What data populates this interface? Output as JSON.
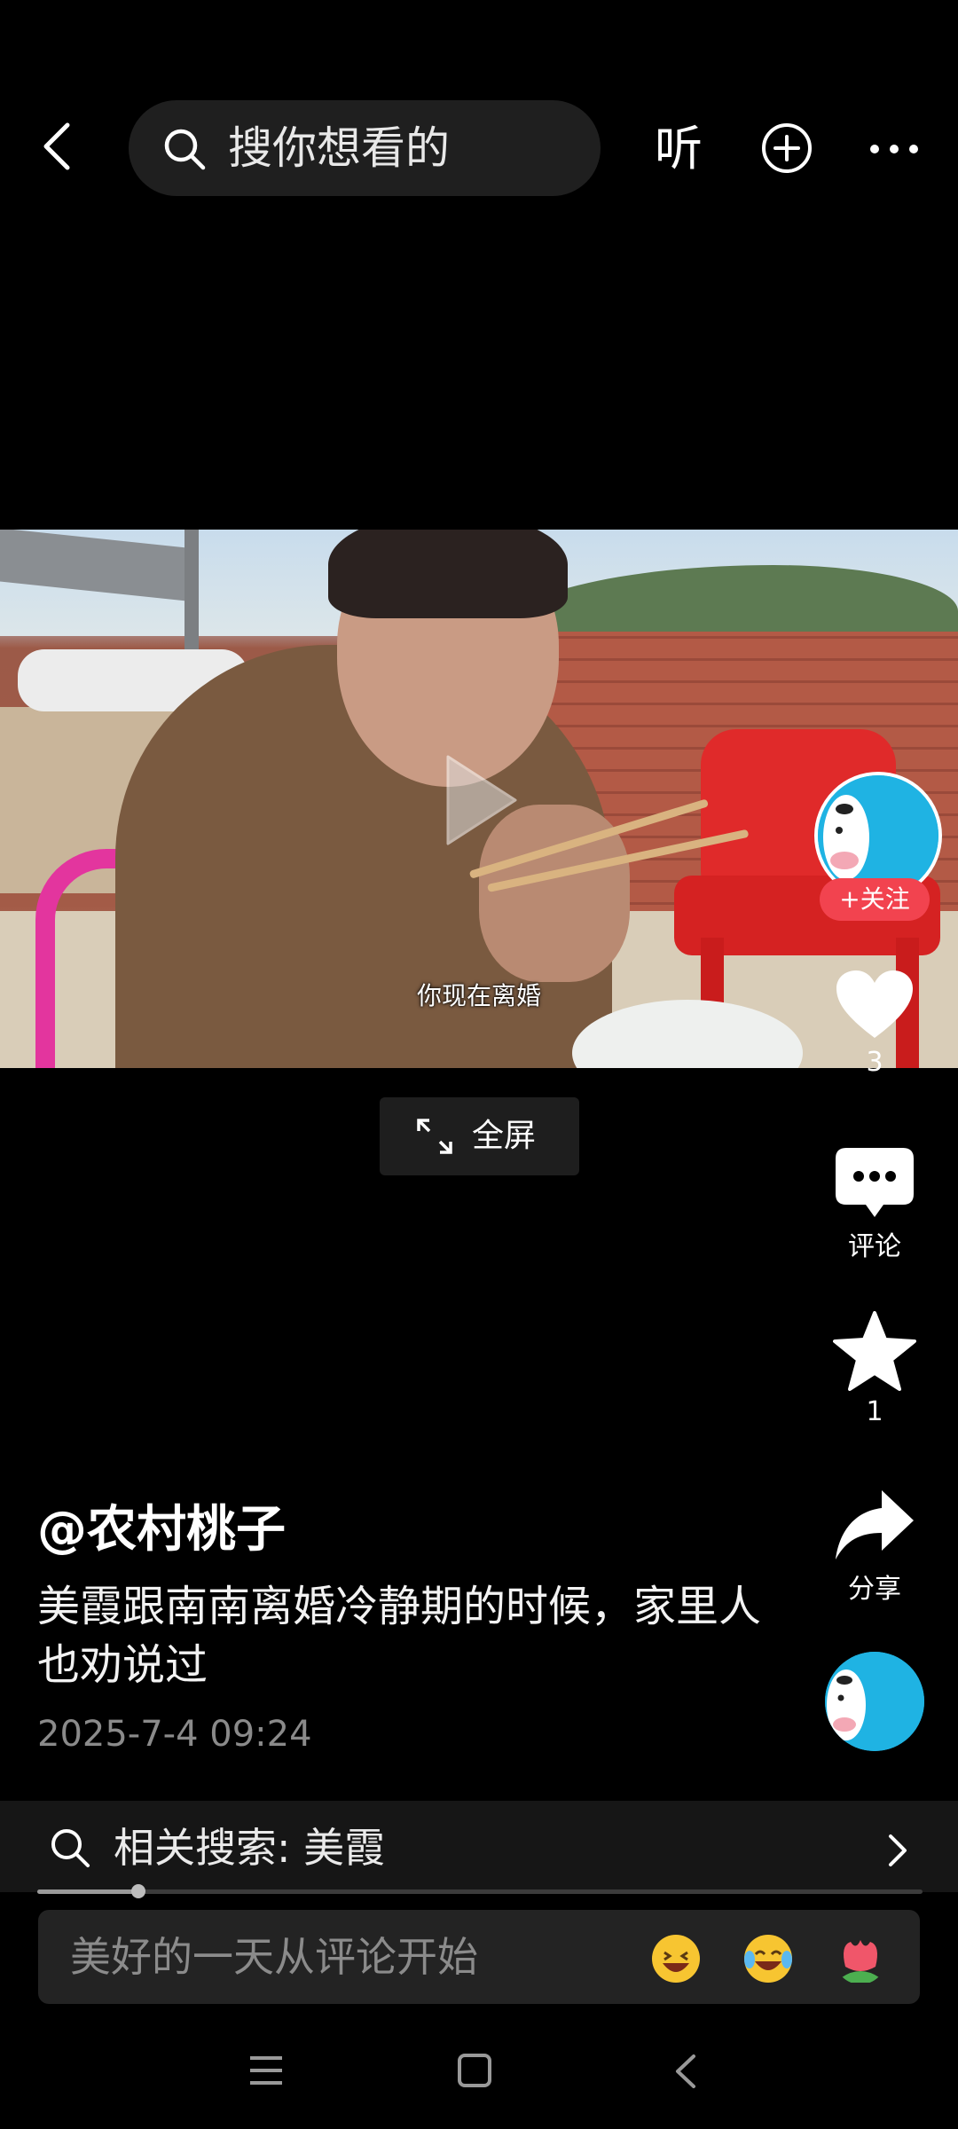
{
  "top_bar": {
    "search_placeholder": "搜你想看的",
    "listen_label": "听",
    "icons": [
      "back-icon",
      "search-icon",
      "add-icon",
      "more-icon"
    ]
  },
  "video": {
    "subtitle": "你现在离婚",
    "fullscreen_label": "全屏"
  },
  "actions": {
    "follow_label": "+关注",
    "like_count": "3",
    "comment_label": "评论",
    "favorite_count": "1",
    "share_label": "分享"
  },
  "post": {
    "author": "@农村桃子",
    "caption": "美霞跟南南离婚冷静期的时候，家里人也劝说过",
    "timestamp": "2025-7-4 09:24"
  },
  "related_search": {
    "label": "相关搜索: 美霞"
  },
  "progress": {
    "fraction": 0.11
  },
  "comment": {
    "placeholder": "美好的一天从评论开始",
    "emojis": [
      "grinning-emoji",
      "laughing-crying-emoji",
      "flower-emoji"
    ]
  },
  "system_nav": [
    "menu-nav",
    "home-nav",
    "back-nav"
  ],
  "colors": {
    "accent_red": "#f2434f",
    "avatar_blue": "#1fb3e3",
    "background": "#000000"
  }
}
